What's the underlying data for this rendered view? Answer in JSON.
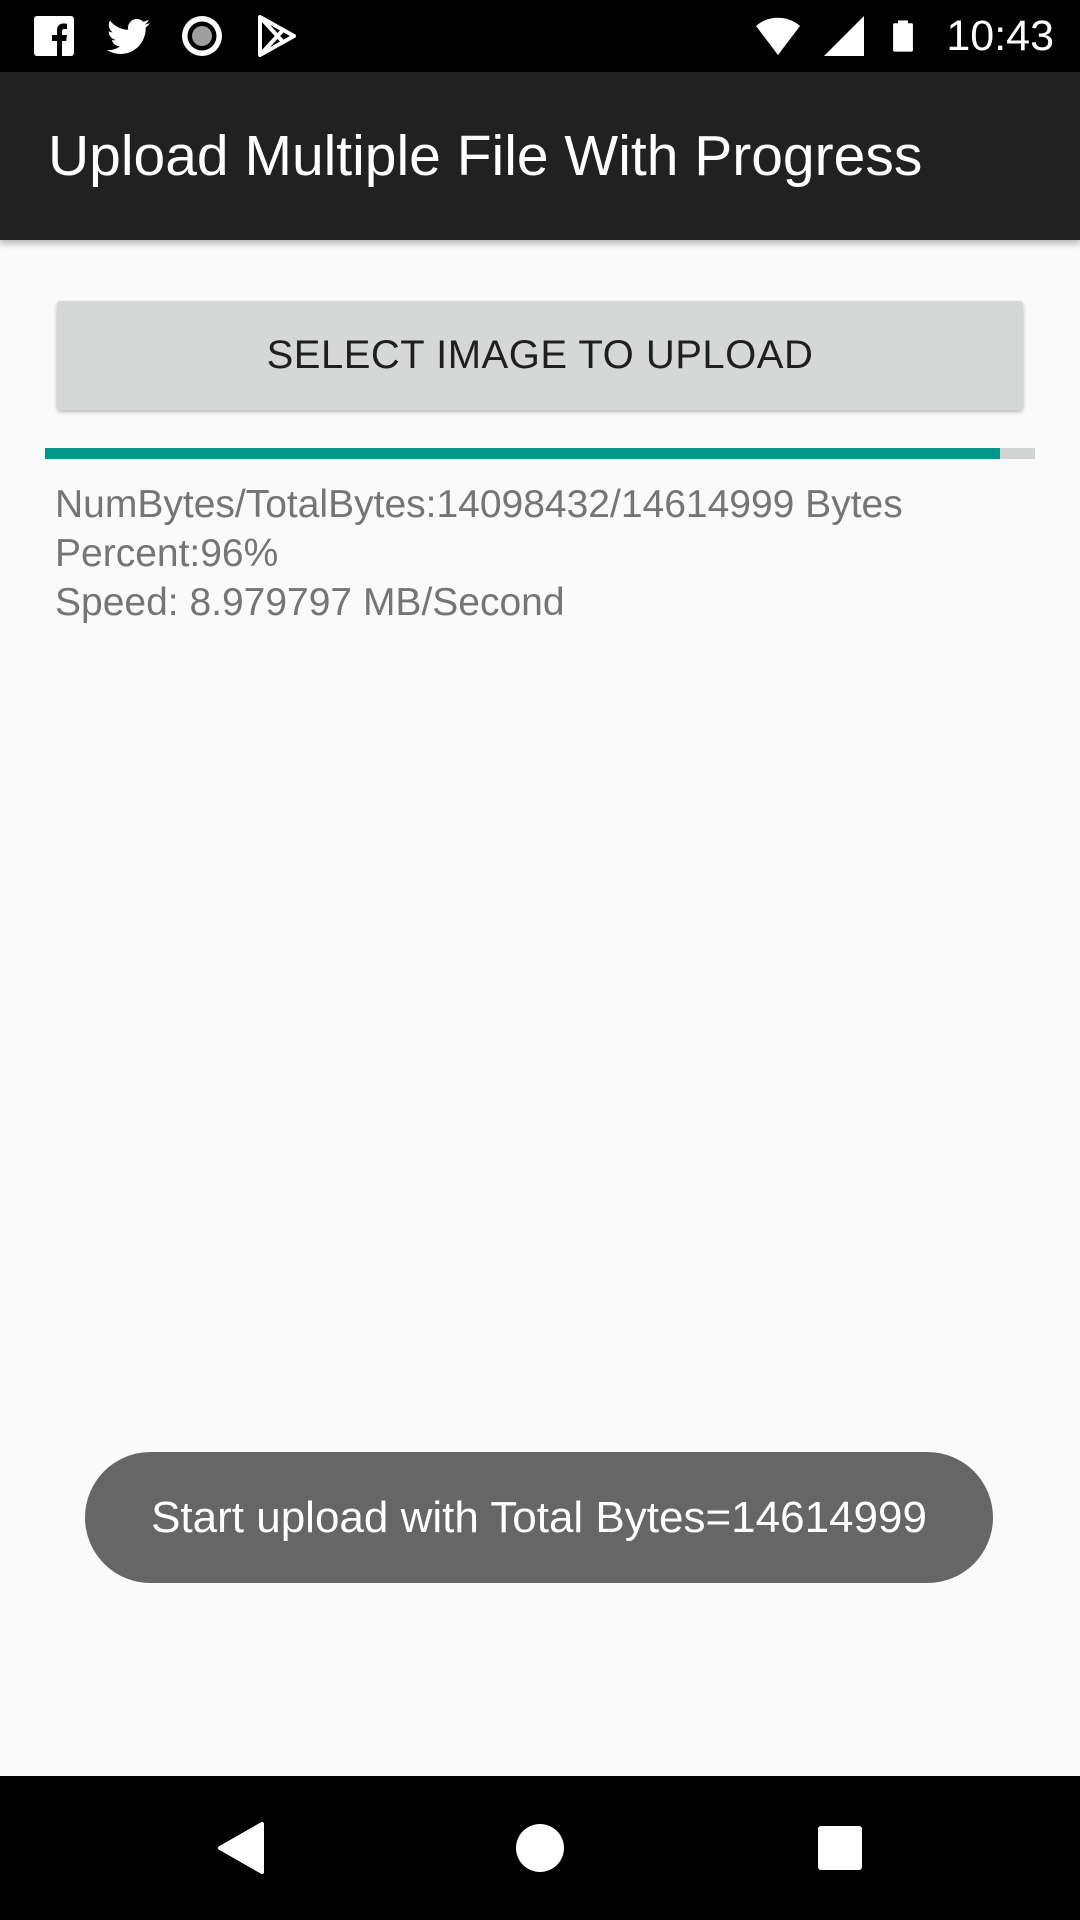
{
  "status_bar": {
    "time": "10:43",
    "left_icons": [
      "facebook-icon",
      "twitter-icon",
      "record-icon",
      "play-store-icon"
    ],
    "right_icons": [
      "wifi-icon",
      "cellular-signal-icon",
      "battery-icon"
    ]
  },
  "app_bar": {
    "title": "Upload Multiple File With Progress",
    "background": "#212121"
  },
  "upload": {
    "button_label": "SELECT IMAGE TO UPLOAD",
    "progress_fraction": 0.9647,
    "progress_color": "#009688",
    "lines": [
      "NumBytes/TotalBytes:14098432/14614999 Bytes",
      "Percent:96%",
      "Speed: 8.979797 MB/Second"
    ]
  },
  "toast": {
    "message": "Start upload with Total Bytes=14614999"
  },
  "nav_bar": {
    "icons": [
      "back-icon",
      "home-icon",
      "recent-apps-icon"
    ]
  }
}
